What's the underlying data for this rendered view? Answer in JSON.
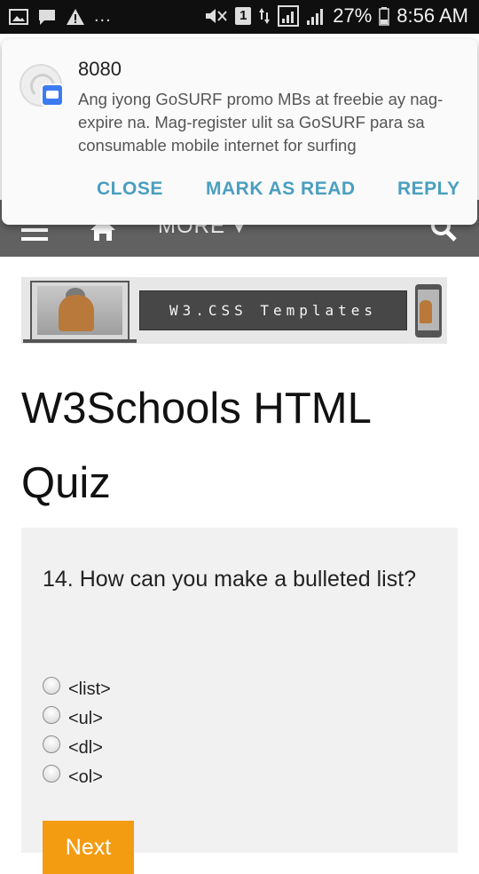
{
  "status_bar": {
    "overflow_dots": "...",
    "battery": "27%",
    "time": "8:56 AM",
    "carrier_badge": "1"
  },
  "navbar": {
    "more_label": "MORE"
  },
  "notification": {
    "title": "8080",
    "body": "Ang iyong GoSURF promo MBs at freebie ay nag-expire na. Mag-register ulit sa GoSURF para sa consumable mobile internet for surfing",
    "actions": {
      "close": "CLOSE",
      "mark_as_read": "MARK AS READ",
      "reply": "REPLY"
    },
    "accent_color": "#4a9fc0"
  },
  "banner": {
    "text": "W3.CSS Templates"
  },
  "page": {
    "title": "W3Schools HTML Quiz"
  },
  "quiz": {
    "question": "14. How can you make a bulleted list?",
    "options": [
      "<list>",
      "<ul>",
      "<dl>",
      "<ol>"
    ],
    "next_label": "Next",
    "next_color": "#f39c12"
  }
}
